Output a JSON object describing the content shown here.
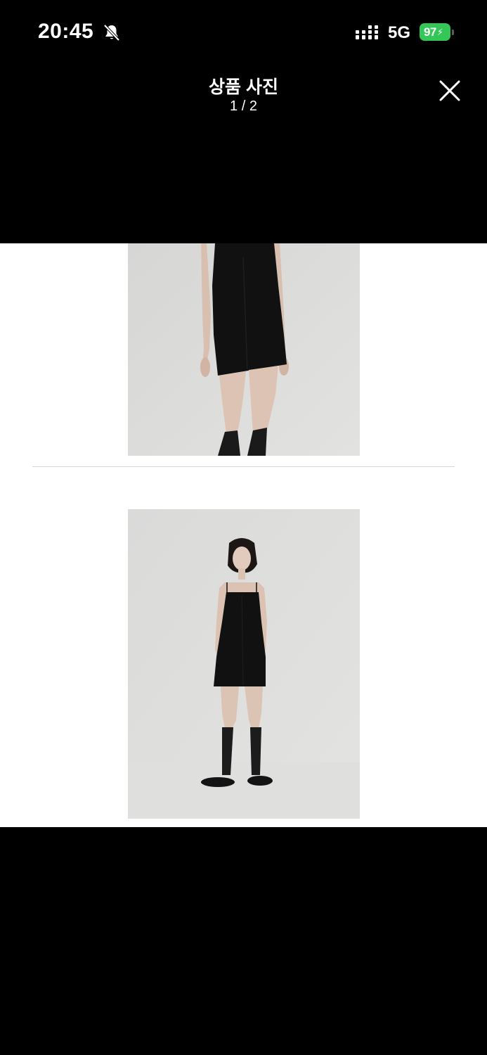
{
  "status_bar": {
    "time": "20:45",
    "network": "5G",
    "battery": "97",
    "battery_color": "#33c758",
    "icons": [
      "bell-off-icon",
      "signal-icon",
      "battery-charging-icon"
    ]
  },
  "header": {
    "title": "상품 사진",
    "counter": "1 / 2",
    "close_icon": "close-icon"
  },
  "photos": [
    {
      "subject": "model-black-mini-dress-lower-body"
    },
    {
      "subject": "model-black-mini-dress-full-body"
    }
  ],
  "colors": {
    "background": "#000000",
    "photo_panel": "#ffffff",
    "photo_backdrop": "#dcdcda",
    "separator": "#d6d6d6"
  }
}
